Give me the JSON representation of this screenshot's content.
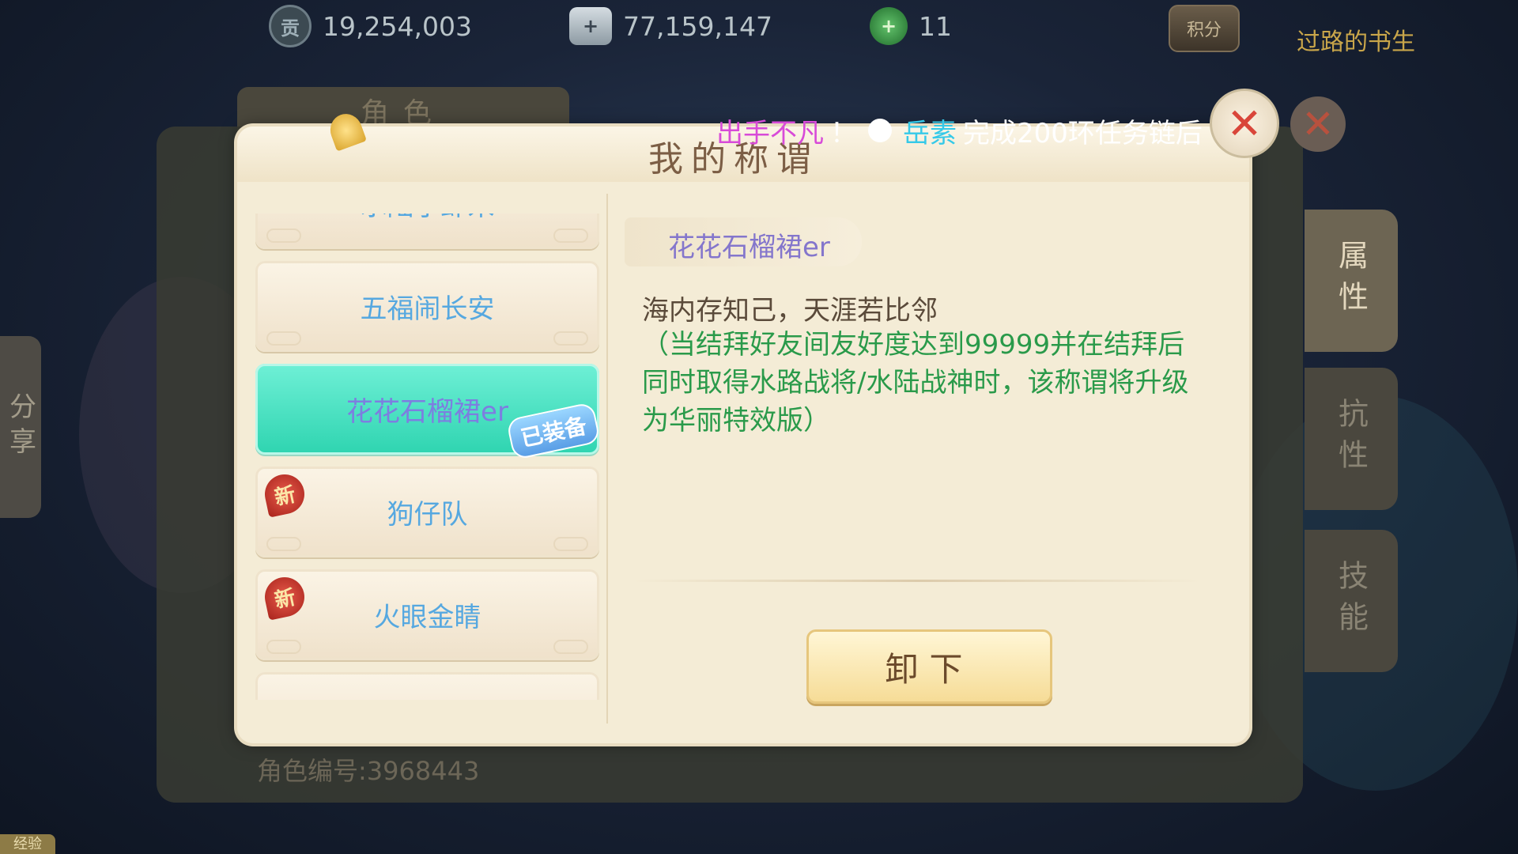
{
  "top_bar": {
    "tribute_icon": "贡",
    "tribute_value": "19,254,003",
    "silver_value": "77,159,147",
    "jade_value": "11",
    "score_label": "积分",
    "player_name": "过路的书生"
  },
  "background": {
    "panel_tab": "角色",
    "role_id": "角色编号:3968443",
    "share_tab": "分享",
    "exp_label": "经验",
    "side_tabs": [
      "属性",
      "抗性",
      "技能"
    ]
  },
  "broadcast": {
    "prefix": "出手不凡",
    "exclaim": "！",
    "player": "岳素",
    "message": "完成200环任务链后"
  },
  "dialog": {
    "title": "我的称谓",
    "close_icon": "close-icon",
    "list": [
      {
        "label": "水陆小虾米",
        "state": "normal",
        "new": false
      },
      {
        "label": "五福闹长安",
        "state": "normal",
        "new": false
      },
      {
        "label": "花花石榴裙er",
        "state": "selected",
        "new": false,
        "tag": "已装备"
      },
      {
        "label": "狗仔队",
        "state": "normal",
        "new": true,
        "new_label": "新"
      },
      {
        "label": "火眼金睛",
        "state": "normal",
        "new": true,
        "new_label": "新"
      }
    ],
    "detail": {
      "title": "花花石榴裙er",
      "poem": "海内存知己，天涯若比邻",
      "description": "（当结拜好友间友好度达到99999并在结拜后同时取得水路战将/水陆战神时，该称谓将升级为华丽特效版）"
    },
    "unequip_label": "卸下"
  },
  "colors": {
    "selected_item": "#2ed4b0",
    "item_text": "#56a8e0",
    "description_text": "#2a9a4a",
    "broadcast_prefix": "#d84bd8",
    "broadcast_name": "#35c9e8"
  }
}
